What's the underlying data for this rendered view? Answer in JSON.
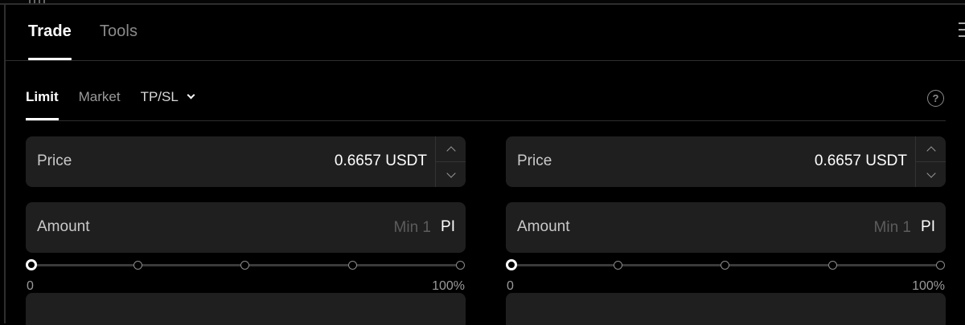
{
  "main_tabs": [
    {
      "label": "Trade",
      "active": true
    },
    {
      "label": "Tools",
      "active": false
    }
  ],
  "sub_tabs": [
    {
      "label": "Limit",
      "active": true
    },
    {
      "label": "Market",
      "active": false
    },
    {
      "label": "TP/SL",
      "active": false,
      "dropdown": true
    }
  ],
  "help_icon": {
    "glyph": "?"
  },
  "buy": {
    "price": {
      "label": "Price",
      "value": "0.6657",
      "unit": "USDT"
    },
    "amount": {
      "label": "Amount",
      "placeholder": "Min 1",
      "unit": "PI"
    },
    "slider": {
      "min_label": "0",
      "max_label": "100%",
      "value": 0
    }
  },
  "sell": {
    "price": {
      "label": "Price",
      "value": "0.6657",
      "unit": "USDT"
    },
    "amount": {
      "label": "Amount",
      "placeholder": "Min 1",
      "unit": "PI"
    },
    "slider": {
      "min_label": "0",
      "max_label": "100%",
      "value": 0
    }
  },
  "colors": {
    "background": "#000000",
    "field": "#1f1f1f",
    "accent": "#ffffff",
    "muted": "#9a9a9a"
  }
}
